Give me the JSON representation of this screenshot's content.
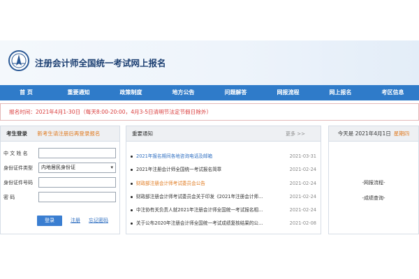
{
  "header": {
    "site_title": "注册会计师全国统一考试网上报名"
  },
  "nav": {
    "items": [
      "首 页",
      "重要通知",
      "政策制度",
      "地方公告",
      "问题解答",
      "网报流程",
      "网上报名",
      "考区信息"
    ]
  },
  "notice": {
    "text": "报名时间：2021年4月1-30日（每天8:00-20:00，4月3-5日清明节法定节假日除外）"
  },
  "login": {
    "title": "考生登录",
    "new_candidate_link": "新考生请注册后再登录报名",
    "fields": [
      {
        "label": "中 文 姓 名",
        "value": ""
      },
      {
        "label": "身份证件类型",
        "value": "内地居民身份证"
      },
      {
        "label": "身份证件号码",
        "value": ""
      },
      {
        "label": "密    码",
        "value": ""
      }
    ],
    "login_button": "登录",
    "register_link": "注册",
    "forgot_link": "忘记密码"
  },
  "news": {
    "title": "重要通知",
    "more": "更多 >>",
    "items": [
      {
        "title": "2021年报名期间各地咨询电话及邮箱",
        "date": "2021-03-31"
      },
      {
        "title": "2021年注册会计师全国统一考试报名简章",
        "date": "2021-02-24"
      },
      {
        "title": "财政部注册会计师考试委员会公告",
        "date": "2021-02-24"
      },
      {
        "title": "财政部注册会计师考试委员会关于印发《2021年注册会计师...",
        "date": "2021-02-24"
      },
      {
        "title": "中注协有关负责人就2021年注册会计师全国统一考试报名相...",
        "date": "2021-02-24"
      },
      {
        "title": "关于公布2020年注册会计师全国统一考试成绩复核结果的公...",
        "date": "2021-02-08"
      }
    ]
  },
  "side": {
    "date_text": "今天是 2021年4月1日",
    "weekday": "星期四",
    "links": [
      "-网报流程-",
      "-成绩查询-"
    ]
  },
  "colors": {
    "nav_bg": "#2f7bc9",
    "notice_red": "#d93a3a",
    "accent_orange": "#e07a1f",
    "link_blue": "#2f6fc1"
  }
}
